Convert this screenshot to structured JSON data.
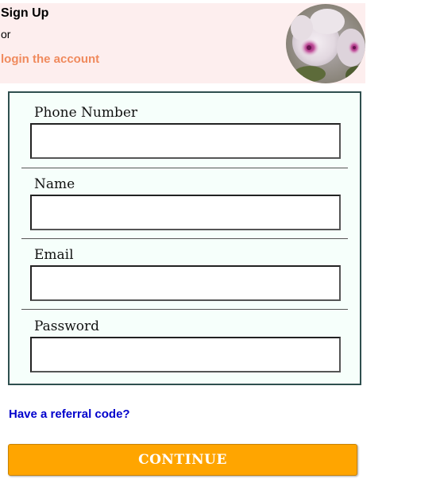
{
  "header": {
    "title": "Sign Up",
    "or_text": "or",
    "login_link": "login the account",
    "background_color": "#fdeeee",
    "link_color": "#f08a5d"
  },
  "form": {
    "fields": [
      {
        "label": "Phone Number",
        "value": "",
        "placeholder": ""
      },
      {
        "label": "Name",
        "value": "",
        "placeholder": ""
      },
      {
        "label": "Email",
        "value": "",
        "placeholder": ""
      },
      {
        "label": "Password",
        "value": "",
        "placeholder": ""
      }
    ],
    "background_color": "#f6fffb",
    "border_color": "#2f4f4f"
  },
  "referral": {
    "link_text": "Have a referral code?",
    "color": "#0000cc"
  },
  "continue_button": {
    "label": "CONTINUE",
    "color": "#ffa500"
  },
  "avatar": {
    "icon": "flower-photo-icon"
  }
}
